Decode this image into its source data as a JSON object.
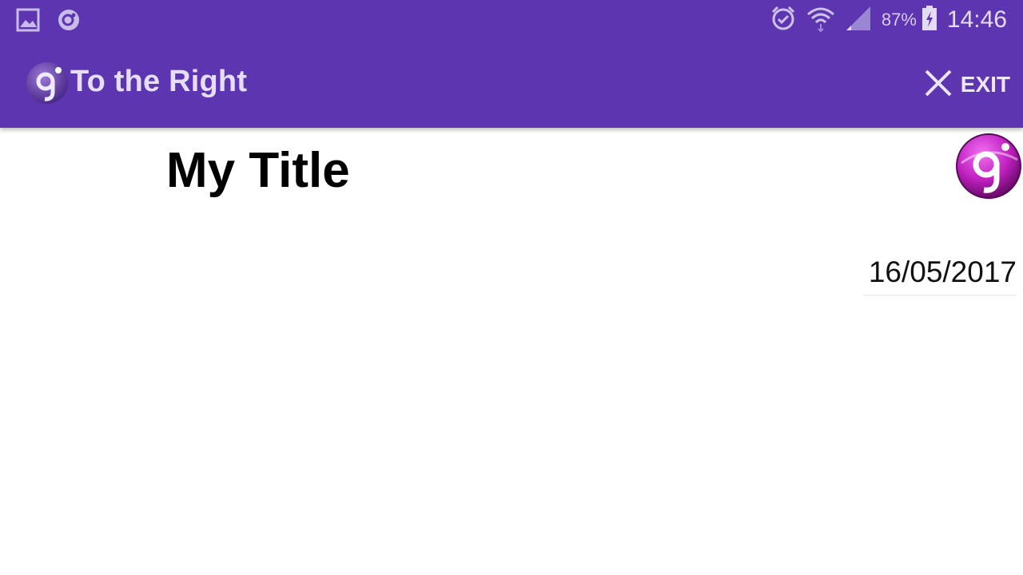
{
  "status_bar": {
    "battery_percent": "87%",
    "time": "14:46",
    "icons": [
      "gallery-icon",
      "app-notification-icon",
      "alarm-icon",
      "wifi-icon",
      "signal-icon",
      "battery-charging-icon"
    ]
  },
  "app_bar": {
    "title": "To the Right",
    "exit_label": "EXIT",
    "icons": [
      "app-logo-icon",
      "close-icon"
    ]
  },
  "content": {
    "title": "My Title",
    "date": "16/05/2017",
    "icons": [
      "app-logo-icon"
    ]
  },
  "colors": {
    "primary": "#5e35b1",
    "logo_accent": "#c020c0"
  }
}
